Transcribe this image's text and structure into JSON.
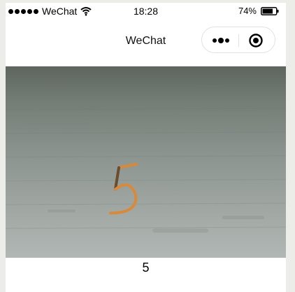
{
  "status_bar": {
    "carrier": "WeChat",
    "time": "18:28",
    "battery": "74%"
  },
  "nav": {
    "title": "WeChat"
  },
  "camera": {
    "handwritten_digit": "5",
    "icon_names": [
      "camera-preview"
    ]
  },
  "result": {
    "text": "5"
  },
  "icons": {
    "signal": "signal-dots-icon",
    "wifi": "wifi-icon",
    "battery": "battery-icon",
    "more": "more-icon",
    "close": "close-target-icon"
  }
}
